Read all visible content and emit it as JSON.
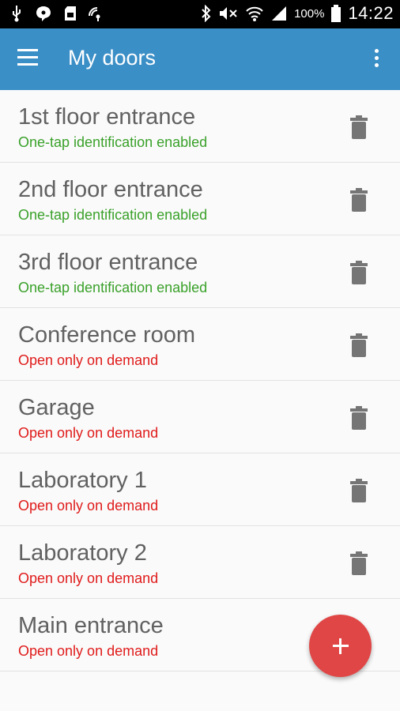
{
  "status_bar": {
    "battery_percent": "100%",
    "time": "14:22",
    "left_icons": [
      "usb-icon",
      "chat-icon",
      "sd-card-icon",
      "signal-dot-icon"
    ],
    "right_icons": [
      "bluetooth-icon",
      "mute-icon",
      "wifi-icon",
      "cell-signal-icon",
      "battery-icon"
    ]
  },
  "app_bar": {
    "title": "My doors",
    "color": "#3b8fc7"
  },
  "doors": [
    {
      "name": "1st floor entrance",
      "status": "One-tap identification enabled",
      "status_color": "#3aa12a"
    },
    {
      "name": "2nd floor entrance",
      "status": "One-tap identification enabled",
      "status_color": "#3aa12a"
    },
    {
      "name": "3rd floor entrance",
      "status": "One-tap identification enabled",
      "status_color": "#3aa12a"
    },
    {
      "name": "Conference room",
      "status": "Open only on demand",
      "status_color": "#e01b1b"
    },
    {
      "name": "Garage",
      "status": "Open only on demand",
      "status_color": "#e01b1b"
    },
    {
      "name": "Laboratory 1",
      "status": "Open only on demand",
      "status_color": "#e01b1b"
    },
    {
      "name": "Laboratory 2",
      "status": "Open only on demand",
      "status_color": "#e01b1b"
    },
    {
      "name": "Main entrance",
      "status": "Open only on demand",
      "status_color": "#e01b1b"
    }
  ],
  "fab": {
    "icon": "plus-icon",
    "color": "#e04646"
  }
}
